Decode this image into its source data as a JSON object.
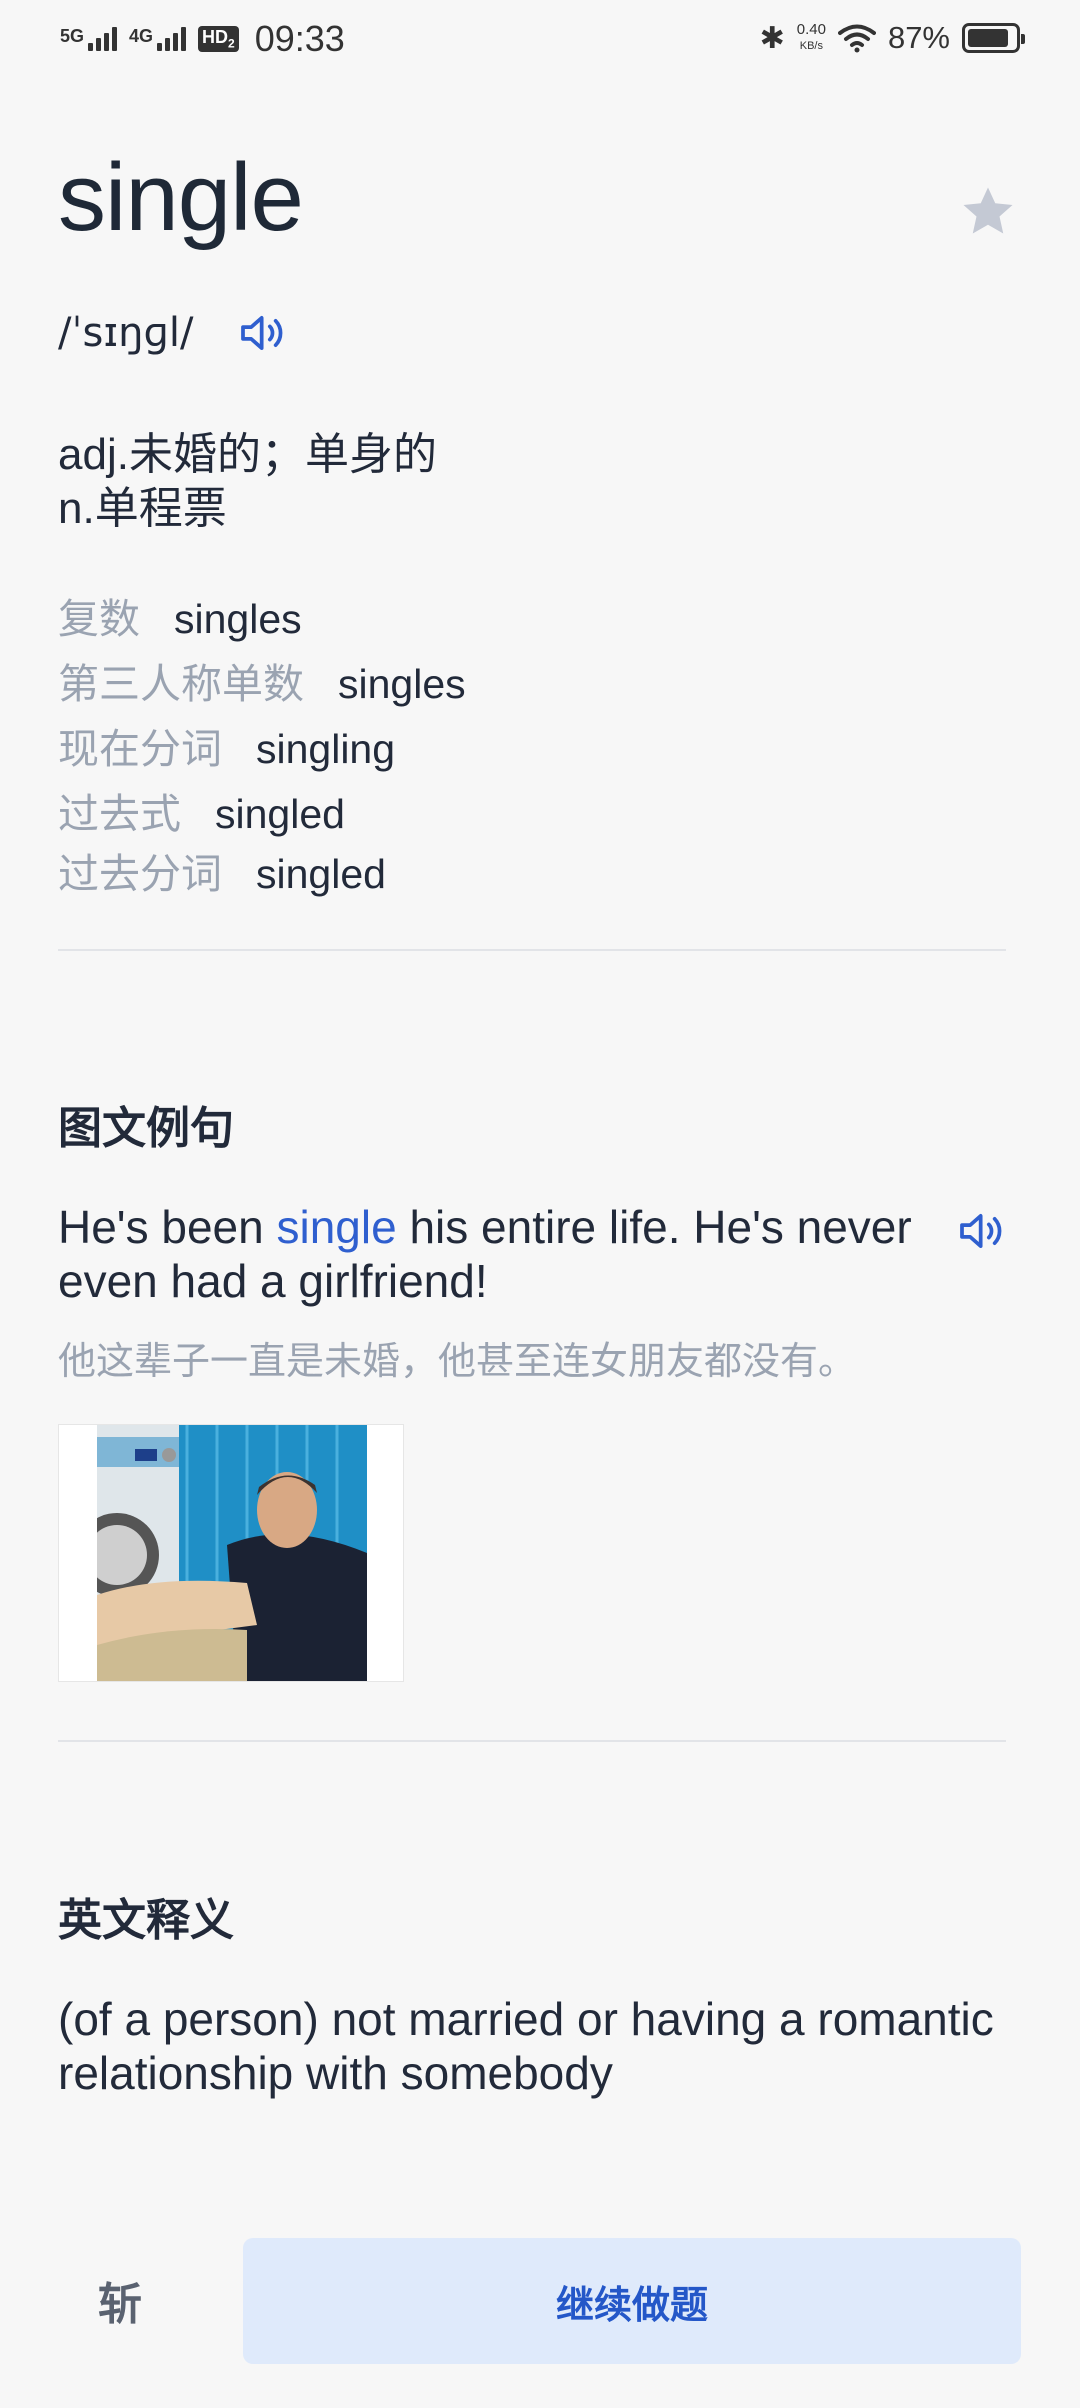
{
  "status_bar": {
    "sig1": "5G",
    "sig2": "4G",
    "hd": "HD",
    "hd_sub": "2",
    "time": "09:33",
    "speed_value": "0.40",
    "speed_unit": "KB/s",
    "battery": "87%",
    "battery_level": 0.87
  },
  "word": {
    "text": "single",
    "phonetic": "/ˈsɪŋɡl/",
    "star_color": "#c4c9d4"
  },
  "definitions": [
    "adj.未婚的；单身的",
    "n.单程票"
  ],
  "forms": [
    {
      "label": "复数",
      "value": "singles"
    },
    {
      "label": "第三人称单数",
      "value": "singles"
    },
    {
      "label": "现在分词",
      "value": "singling"
    },
    {
      "label": "过去式",
      "value": "singled"
    },
    {
      "label": "过去分词",
      "value": "singled"
    }
  ],
  "example_section": {
    "title": "图文例句",
    "sentence_before": "He's been ",
    "sentence_highlight": "single",
    "sentence_after": " his entire life. He's never even had a girlfriend!",
    "translation": "他这辈子一直是未婚，他甚至连女朋友都没有。"
  },
  "english_section": {
    "title": "英文释义",
    "definition": "(of a person) not married or having a romantic relationship with somebody"
  },
  "bottom": {
    "cut_label": "斩",
    "continue_label": "继续做题"
  },
  "colors": {
    "accent": "#2f5fcf",
    "muted": "#9aa3b1",
    "button_bg": "#dfeafb"
  }
}
